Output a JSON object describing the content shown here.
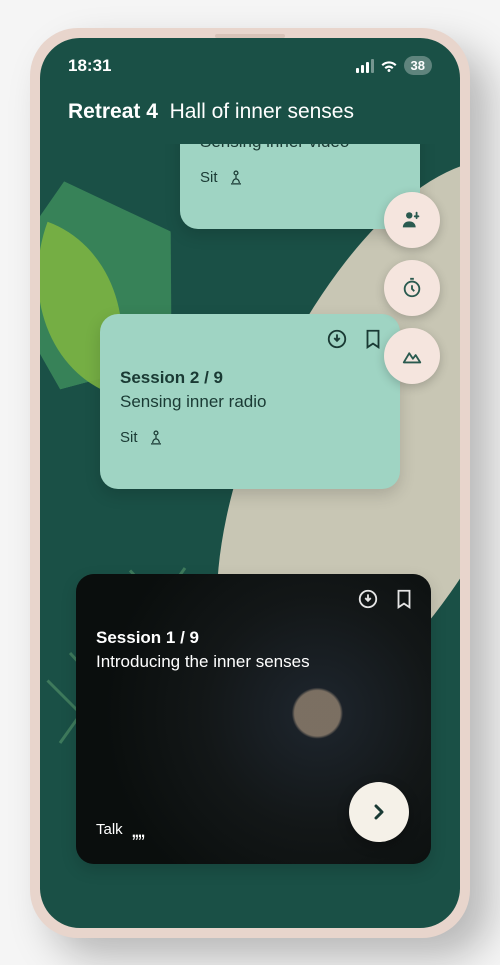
{
  "status": {
    "time": "18:31",
    "battery": "38"
  },
  "header": {
    "prefix": "Retreat 4",
    "title": "Hall of inner senses"
  },
  "cards": {
    "top": {
      "title": "Sensing inner video",
      "type": "Sit"
    },
    "mid": {
      "session": "Session 2 / 9",
      "title": "Sensing inner radio",
      "type": "Sit"
    },
    "bottom": {
      "session": "Session 1 / 9",
      "title": "Introducing the inner senses",
      "type": "Talk"
    }
  }
}
